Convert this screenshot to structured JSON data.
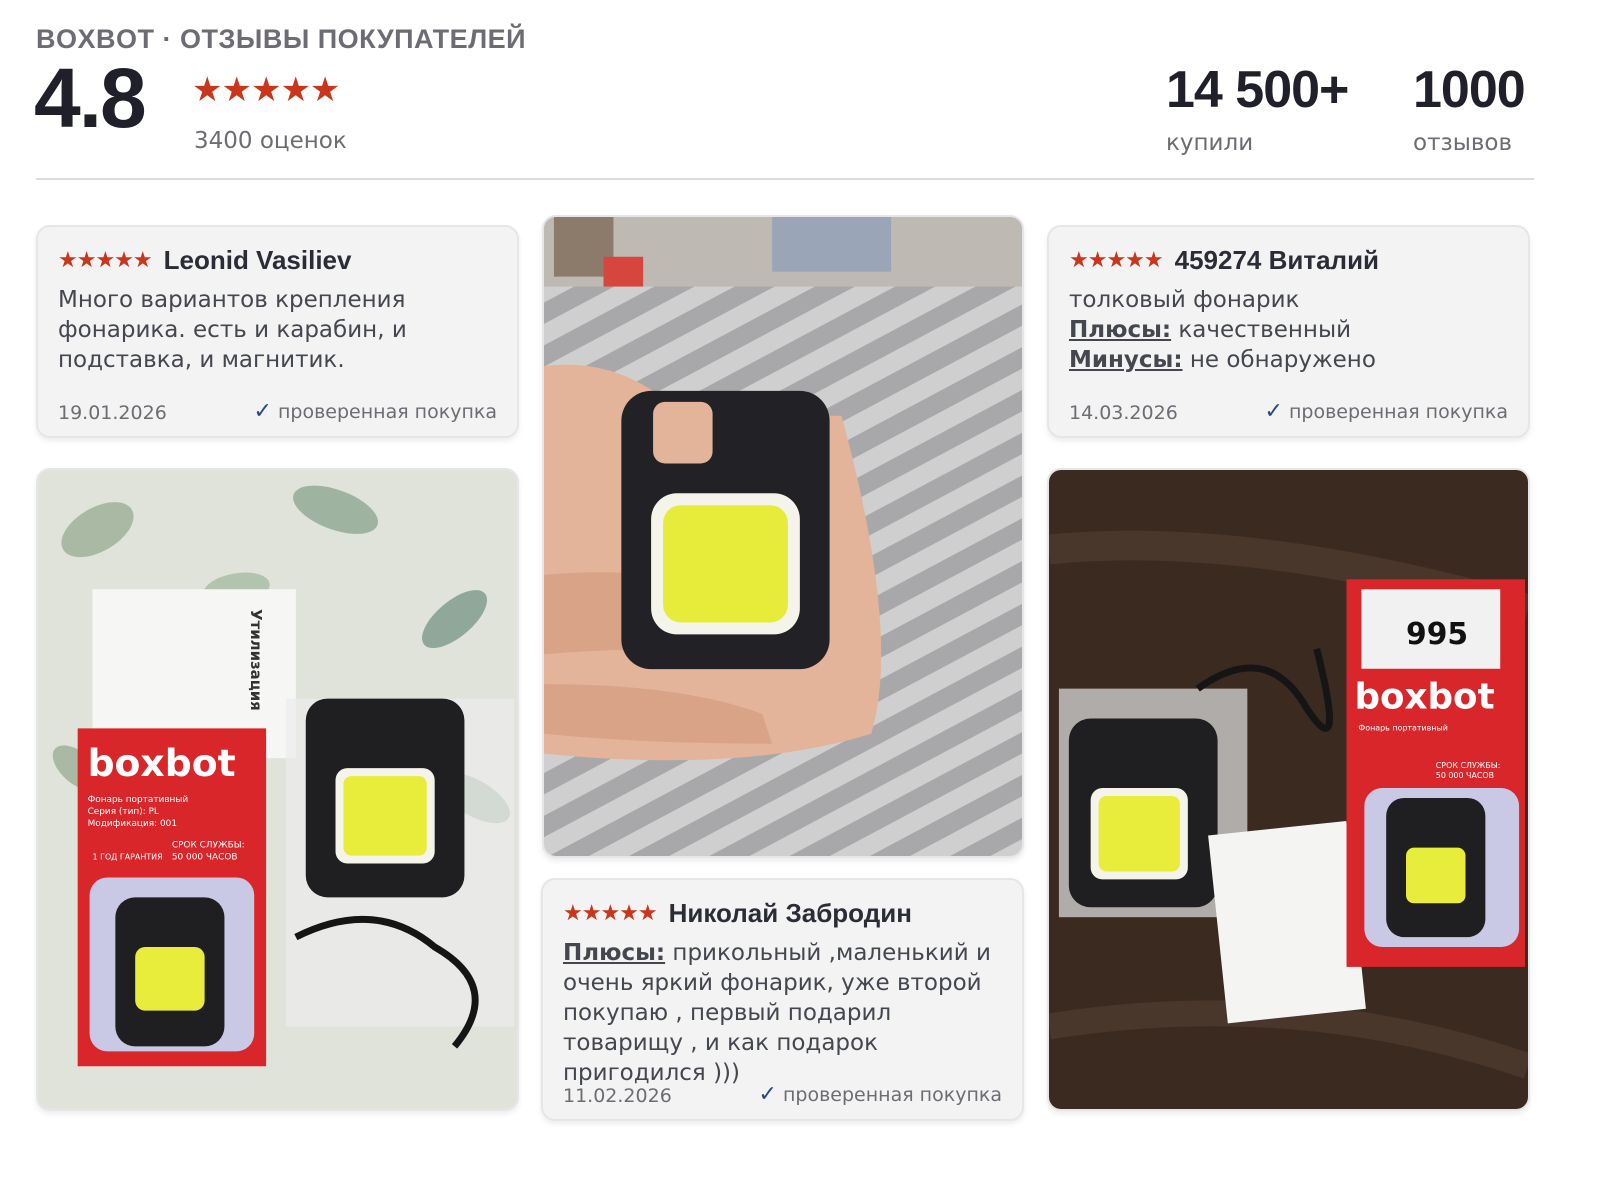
{
  "header": {
    "subtitle": "BOXBOT · ОТЗЫВЫ ПОКУПАТЕЛЕЙ",
    "rating": "4.8",
    "stars": "★★★★★",
    "ratings_count": "3400 оценок",
    "stats": [
      {
        "value": "14 500+",
        "label": "купили"
      },
      {
        "value": "1000",
        "label": "отзывов"
      }
    ]
  },
  "reviews": [
    {
      "stars": "★★★★★",
      "author": "Leonid Vasiliev",
      "text": "Много вариантов крепления фонарика. есть и карабин, и подставка, и магнитик.",
      "date": "19.01.2026",
      "verified": "проверенная покупка"
    },
    {
      "stars": "★★★★★",
      "author": "459274 Виталий",
      "line1": "толковый фонарик",
      "pros_label": "Плюсы:",
      "pros": " качественный",
      "cons_label": "Минусы:",
      "cons": " не обнаружено",
      "date": "14.03.2026",
      "verified": "проверенная покупка"
    },
    {
      "stars": "★★★★★",
      "author": "Николай Забродин",
      "pros_label": "Плюсы:",
      "pros": " прикольный ,маленький и очень яркий фонарик, уже второй покупаю , первый подарил товарищу , и как подарок пригодился )))",
      "date": "11.02.2026",
      "verified": "проверенная покупка"
    }
  ],
  "photos": {
    "brand": "boxbot",
    "box_line1": "Фонарь портативный",
    "box_line2": "Серия (тип): PL",
    "box_line3": "Модификация: 001",
    "box_service": "СРОК СЛУЖБЫ:",
    "box_hours": "50 000 ЧАСОВ",
    "box_warranty": "1 ГОД  ГАРАНТИЯ",
    "leaflet_title": "Утилизация",
    "sticker_code": "995"
  },
  "colors": {
    "star": "#c9361b",
    "check": "#214a8a",
    "box_red": "#d8262b"
  }
}
